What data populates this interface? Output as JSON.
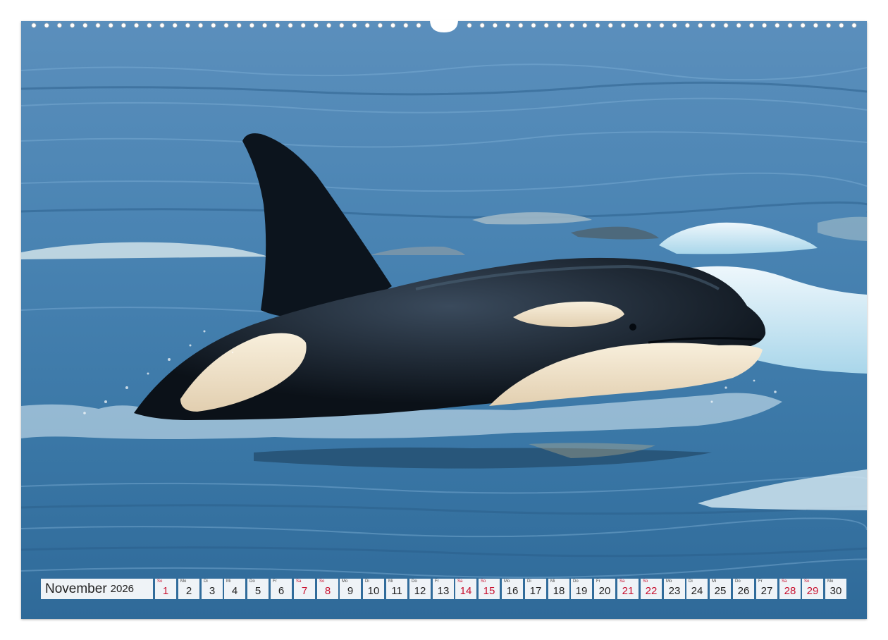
{
  "calendar": {
    "month": "November",
    "year": "2026",
    "weekend_color": "#c8102e",
    "days": [
      {
        "dow": "So",
        "num": "1",
        "weekend": true
      },
      {
        "dow": "Mo",
        "num": "2",
        "weekend": false
      },
      {
        "dow": "Di",
        "num": "3",
        "weekend": false
      },
      {
        "dow": "Mi",
        "num": "4",
        "weekend": false
      },
      {
        "dow": "Do",
        "num": "5",
        "weekend": false
      },
      {
        "dow": "Fr",
        "num": "6",
        "weekend": false
      },
      {
        "dow": "Sa",
        "num": "7",
        "weekend": true
      },
      {
        "dow": "So",
        "num": "8",
        "weekend": true
      },
      {
        "dow": "Mo",
        "num": "9",
        "weekend": false
      },
      {
        "dow": "Di",
        "num": "10",
        "weekend": false
      },
      {
        "dow": "Mi",
        "num": "11",
        "weekend": false
      },
      {
        "dow": "Do",
        "num": "12",
        "weekend": false
      },
      {
        "dow": "Fr",
        "num": "13",
        "weekend": false
      },
      {
        "dow": "Sa",
        "num": "14",
        "weekend": true
      },
      {
        "dow": "So",
        "num": "15",
        "weekend": true
      },
      {
        "dow": "Mo",
        "num": "16",
        "weekend": false
      },
      {
        "dow": "Di",
        "num": "17",
        "weekend": false
      },
      {
        "dow": "Mi",
        "num": "18",
        "weekend": false
      },
      {
        "dow": "Do",
        "num": "19",
        "weekend": false
      },
      {
        "dow": "Fr",
        "num": "20",
        "weekend": false
      },
      {
        "dow": "Sa",
        "num": "21",
        "weekend": true
      },
      {
        "dow": "So",
        "num": "22",
        "weekend": true
      },
      {
        "dow": "Mo",
        "num": "23",
        "weekend": false
      },
      {
        "dow": "Di",
        "num": "24",
        "weekend": false
      },
      {
        "dow": "Mi",
        "num": "25",
        "weekend": false
      },
      {
        "dow": "Do",
        "num": "26",
        "weekend": false
      },
      {
        "dow": "Fr",
        "num": "27",
        "weekend": false
      },
      {
        "dow": "Sa",
        "num": "28",
        "weekend": true
      },
      {
        "dow": "So",
        "num": "29",
        "weekend": true
      },
      {
        "dow": "Mo",
        "num": "30",
        "weekend": false
      }
    ]
  },
  "photo": {
    "subject": "orca-surfacing",
    "water_color": "#3f7eaa",
    "body_color": "#0e1620",
    "patch_color": "#efe3cc"
  },
  "binding": {
    "hole_color": "#ffffff"
  }
}
